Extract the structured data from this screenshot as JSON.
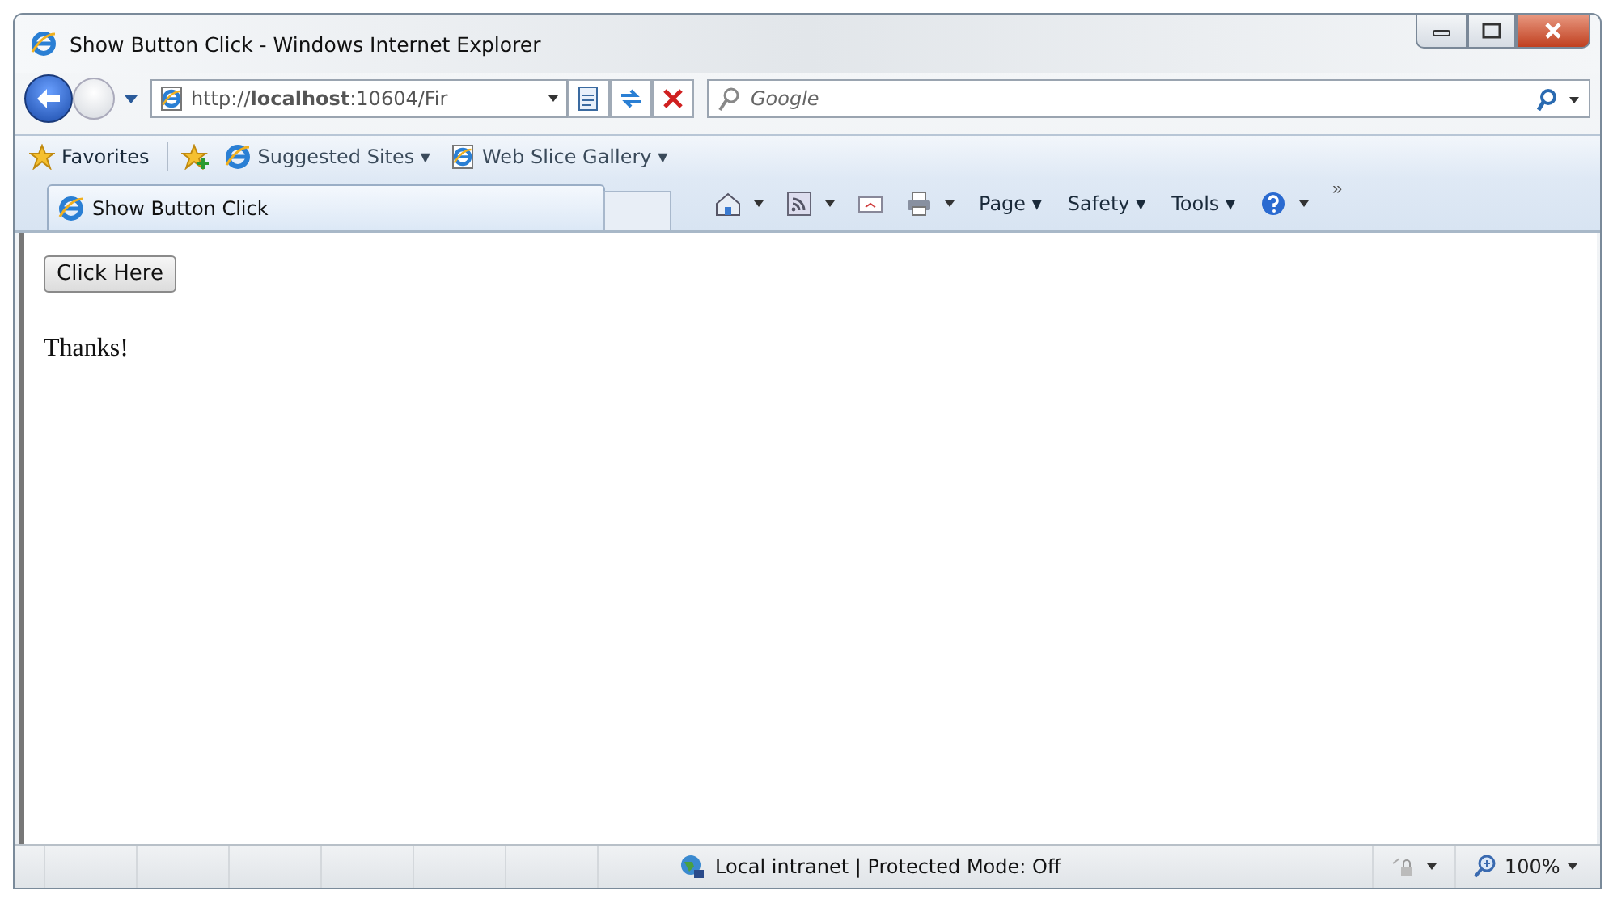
{
  "window": {
    "title": "Show Button Click - Windows Internet Explorer"
  },
  "address_bar": {
    "value": "http://**localhost**:10604/Fir"
  },
  "search": {
    "placeholder": "Google"
  },
  "favorites_bar": {
    "label": "Favorites",
    "links": [
      {
        "label": "Suggested Sites ▾",
        "kind": "ie"
      },
      {
        "label": "Web Slice Gallery ▾",
        "kind": "page"
      }
    ]
  },
  "tabs": [
    {
      "label": "Show Button Click",
      "selected": true
    }
  ],
  "command_bar": {
    "menus": [
      "Page ▾",
      "Safety ▾",
      "Tools ▾"
    ],
    "overflow": "»"
  },
  "page": {
    "button": "Click Here",
    "message": "Thanks!"
  },
  "status_bar": {
    "zone": "Local intranet | Protected Mode: Off",
    "zoom": "100%"
  }
}
